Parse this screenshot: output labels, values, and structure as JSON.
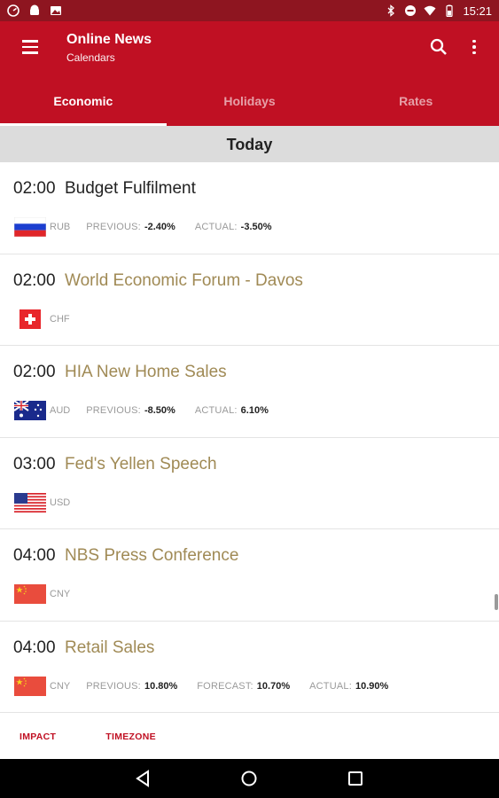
{
  "status_bar": {
    "time": "15:21",
    "left_icons": [
      "speedometer-icon",
      "android-icon",
      "image-icon"
    ],
    "right_icons": [
      "bluetooth-icon",
      "do-not-disturb-icon",
      "wifi-icon",
      "battery-icon"
    ]
  },
  "app_bar": {
    "title": "Online News",
    "subtitle": "Calendars",
    "menu_icon": "menu-icon",
    "search_icon": "search-icon",
    "more_icon": "more-vert-icon"
  },
  "tabs": [
    {
      "label": "Economic",
      "active": true
    },
    {
      "label": "Holidays",
      "active": false
    },
    {
      "label": "Rates",
      "active": false
    }
  ],
  "day_header": "Today",
  "events": [
    {
      "time": "02:00",
      "title": "Budget Fulfilment",
      "title_style": "dark",
      "flag": "russia-flag-icon",
      "currency": "RUB",
      "previous_label": "PREVIOUS:",
      "previous": "-2.40%",
      "forecast_label": "",
      "forecast": "",
      "actual_label": "ACTUAL:",
      "actual": "-3.50%"
    },
    {
      "time": "02:00",
      "title": "World Economic Forum - Davos",
      "title_style": "gold",
      "flag": "switzerland-flag-icon",
      "currency": "CHF",
      "previous_label": "",
      "previous": "",
      "forecast_label": "",
      "forecast": "",
      "actual_label": "",
      "actual": ""
    },
    {
      "time": "02:00",
      "title": "HIA New Home Sales",
      "title_style": "gold",
      "flag": "australia-flag-icon",
      "currency": "AUD",
      "previous_label": "PREVIOUS:",
      "previous": "-8.50%",
      "forecast_label": "",
      "forecast": "",
      "actual_label": "ACTUAL:",
      "actual": "6.10%"
    },
    {
      "time": "03:00",
      "title": "Fed's Yellen Speech",
      "title_style": "gold",
      "flag": "usa-flag-icon",
      "currency": "USD",
      "previous_label": "",
      "previous": "",
      "forecast_label": "",
      "forecast": "",
      "actual_label": "",
      "actual": ""
    },
    {
      "time": "04:00",
      "title": "NBS Press Conference",
      "title_style": "gold",
      "flag": "china-flag-icon",
      "currency": "CNY",
      "previous_label": "",
      "previous": "",
      "forecast_label": "",
      "forecast": "",
      "actual_label": "",
      "actual": ""
    },
    {
      "time": "04:00",
      "title": "Retail Sales",
      "title_style": "gold",
      "flag": "china-flag-icon",
      "currency": "CNY",
      "previous_label": "PREVIOUS:",
      "previous": "10.80%",
      "forecast_label": "FORECAST:",
      "forecast": "10.70%",
      "actual_label": "ACTUAL:",
      "actual": "10.90%"
    }
  ],
  "bottom_actions": {
    "impact": "IMPACT",
    "timezone": "TIMEZONE"
  },
  "nav_bar": {
    "icons": [
      "back-icon",
      "home-icon",
      "recents-icon"
    ]
  },
  "colors": {
    "primary": "#c01023",
    "status_bar": "#8e1520",
    "title_gold": "#a08a55",
    "header_gray": "#dcdcdc"
  }
}
